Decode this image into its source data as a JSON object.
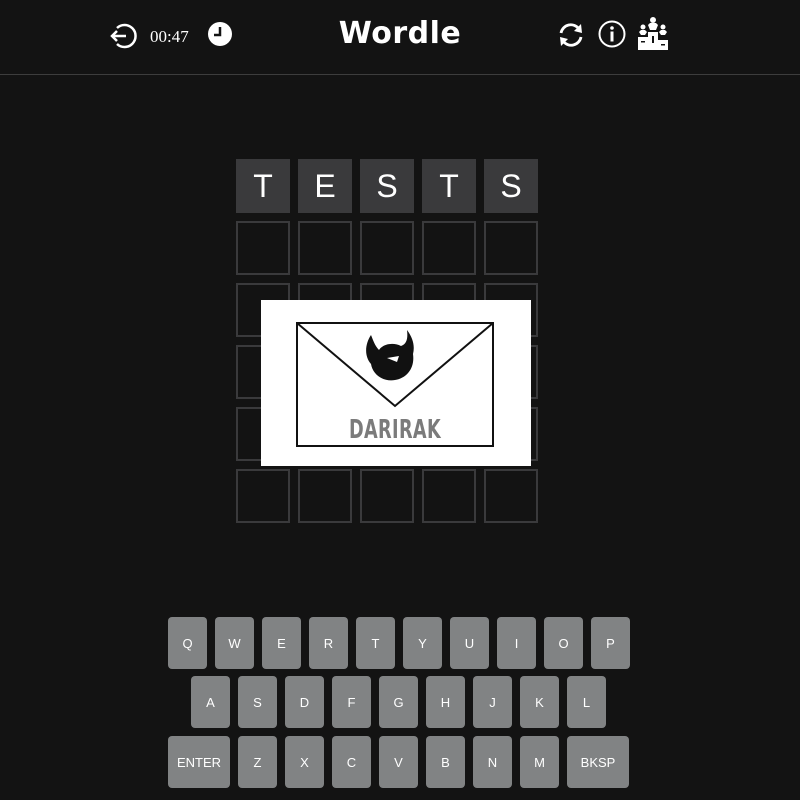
{
  "header": {
    "title": "Wordle",
    "timer": "00:47",
    "icons": [
      "back-icon",
      "clock-icon",
      "refresh-icon",
      "info-icon",
      "leaderboard-icon"
    ]
  },
  "board": {
    "rows": [
      [
        "T",
        "E",
        "S",
        "T",
        "S"
      ],
      [
        "",
        "",
        "",
        "",
        ""
      ],
      [
        "",
        "",
        "",
        "",
        ""
      ],
      [
        "",
        "",
        "",
        "",
        ""
      ],
      [
        "",
        "",
        "",
        "",
        ""
      ],
      [
        "",
        "",
        "",
        "",
        ""
      ]
    ]
  },
  "overlay": {
    "brand_text": "DARIRAK"
  },
  "keyboard": {
    "rows": [
      [
        "Q",
        "W",
        "E",
        "R",
        "T",
        "Y",
        "U",
        "I",
        "O",
        "P"
      ],
      [
        "A",
        "S",
        "D",
        "F",
        "G",
        "H",
        "J",
        "K",
        "L"
      ],
      [
        "ENTER",
        "Z",
        "X",
        "C",
        "V",
        "B",
        "N",
        "M",
        "BKSP"
      ]
    ]
  },
  "colors": {
    "background": "#131313",
    "tile_filled": "#3a3a3c",
    "tile_border": "#3a3a3c",
    "key": "#818384"
  }
}
